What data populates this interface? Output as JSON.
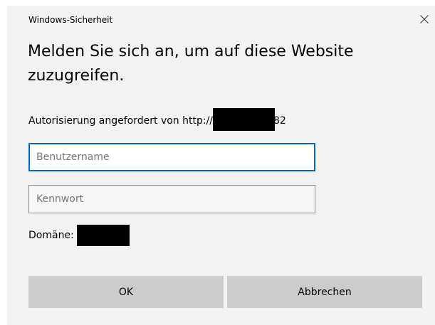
{
  "window": {
    "title": "Windows-Sicherheit",
    "close_glyph": "close-icon"
  },
  "heading": "Melden Sie sich an, um auf diese Website zuzugreifen.",
  "auth": {
    "prefix": "Autorisierung angefordert von http://",
    "suffix": "82"
  },
  "username": {
    "placeholder": "Benutzername",
    "value": ""
  },
  "password": {
    "placeholder": "Kennwort",
    "value": ""
  },
  "domain": {
    "label": "Domäne:"
  },
  "buttons": {
    "ok": "OK",
    "cancel": "Abbrechen"
  },
  "colors": {
    "dialog_bg": "#f2f2f2",
    "button_bg": "#cccccc",
    "focus_border": "#0067c0",
    "redaction": "#000000"
  }
}
